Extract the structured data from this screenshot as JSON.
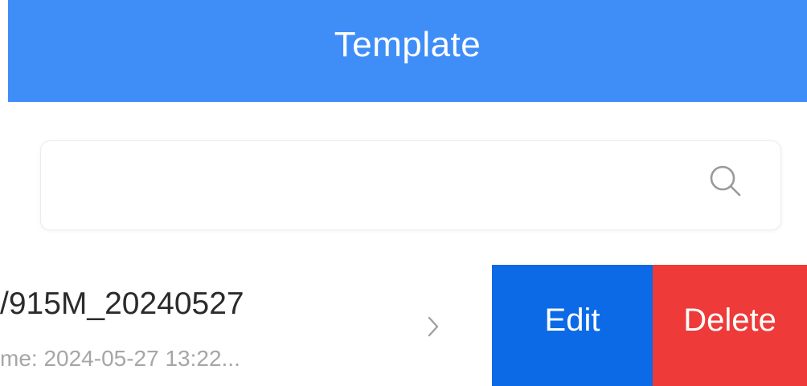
{
  "header": {
    "title": "Template"
  },
  "search": {
    "value": "",
    "placeholder": "",
    "icon": "search-icon"
  },
  "list": {
    "items": [
      {
        "title": "/915M_20240527",
        "subtitle": "me: 2024-05-27 13:22...",
        "chevron_icon": "chevron-right-icon",
        "actions": {
          "edit_label": "Edit",
          "delete_label": "Delete"
        }
      }
    ]
  },
  "colors": {
    "header_bg": "#3f8ef8",
    "edit_bg": "#0c6ae7",
    "delete_bg": "#ee3a38",
    "title_text": "#2b2b2b",
    "subtitle_text": "#a6a6a6"
  }
}
